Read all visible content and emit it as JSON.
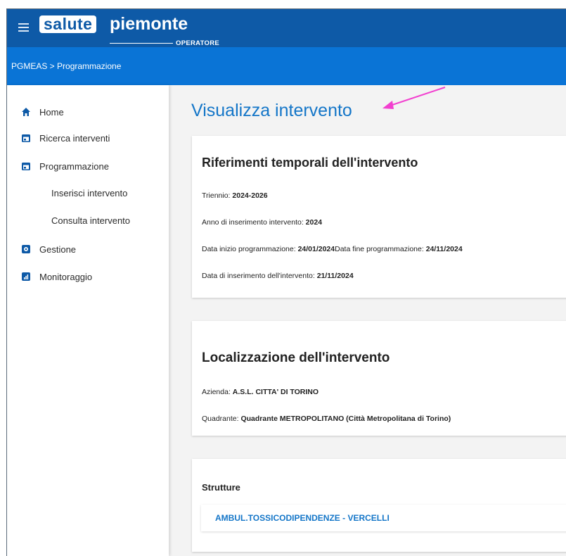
{
  "header": {
    "logo_box": "salute",
    "logo_word": "piemonte",
    "logo_sub": "OPERATORE",
    "colors": {
      "top": "#0e5aa7",
      "breadcrumb_bar": "#0a74d6",
      "accent": "#1476c8"
    }
  },
  "breadcrumb": "PGMEAS > Programmazione",
  "sidebar": {
    "items": [
      {
        "label": "Home",
        "icon": "home-icon"
      },
      {
        "label": "Ricerca interventi",
        "icon": "calendar-icon"
      },
      {
        "label": "Programmazione",
        "icon": "calendar-icon"
      },
      {
        "label": "Gestione",
        "icon": "gear-icon"
      },
      {
        "label": "Monitoraggio",
        "icon": "bar-chart-icon"
      }
    ],
    "subitems": [
      {
        "label": "Inserisci intervento"
      },
      {
        "label": "Consulta intervento"
      }
    ]
  },
  "main": {
    "title": "Visualizza intervento",
    "cards": {
      "temporali": {
        "title": "Riferimenti temporali dell'intervento",
        "triennio_label": "Triennio: ",
        "triennio_value": "2024-2026",
        "anno_label": "Anno di inserimento intervento: ",
        "anno_value": "2024",
        "inizio_label": "Data inizio programmazione: ",
        "inizio_value": "24/01/2024",
        "fine_label": "Data fine programmazione: ",
        "fine_value": "24/11/2024",
        "inserimento_label": "Data di inserimento dell'intervento: ",
        "inserimento_value": "21/11/2024"
      },
      "localizzazione": {
        "title": "Localizzazione dell'intervento",
        "azienda_label": "Azienda: ",
        "azienda_value": "A.S.L. CITTA' DI TORINO",
        "quadrante_label": "Quadrante: ",
        "quadrante_value": "Quadrante METROPOLITANO (Città Metropolitana di Torino)"
      },
      "strutture": {
        "title": "Strutture",
        "items": [
          "AMBUL.TOSSICODIPENDENZE - VERCELLI"
        ]
      }
    }
  }
}
